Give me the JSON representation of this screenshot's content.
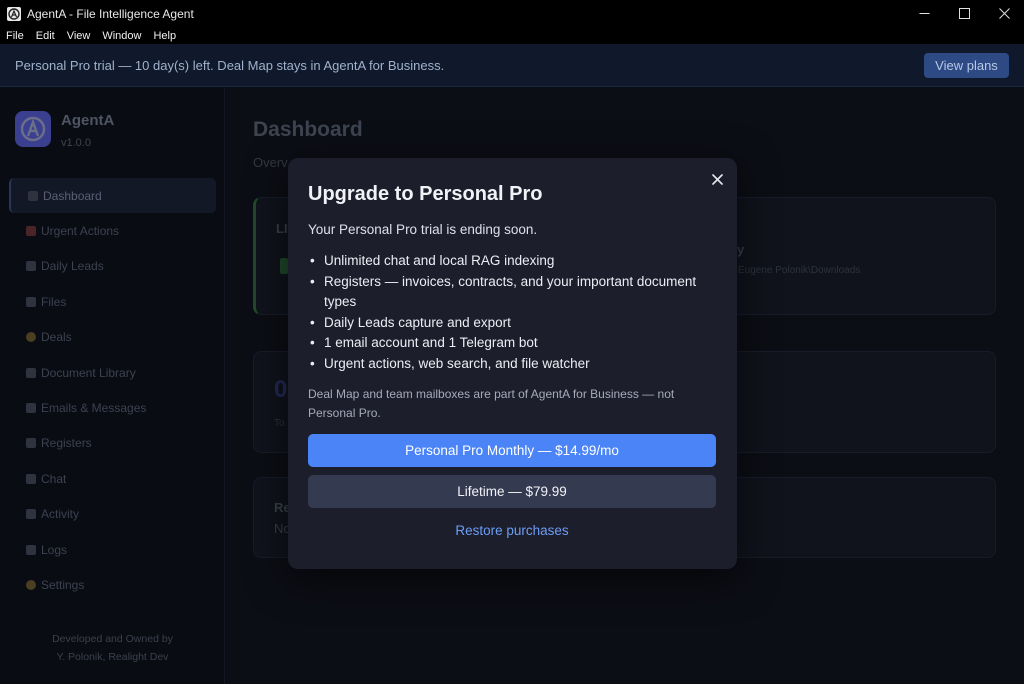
{
  "window": {
    "title": "AgentA - File Intelligence Agent",
    "app_icon": "agenta-logo-icon",
    "controls": [
      "minimize-icon",
      "maximize-icon",
      "close-icon"
    ]
  },
  "menu": [
    "File",
    "Edit",
    "View",
    "Window",
    "Help"
  ],
  "banner": {
    "text": "Personal Pro trial — 10 day(s) left. Deal Map stays in AgentA for Business.",
    "button": "View plans"
  },
  "sidebar": {
    "brand_name": "AgentA",
    "version": "v1.0.0",
    "items": [
      {
        "label": "Dashboard",
        "icon": "chart-icon"
      },
      {
        "label": "Urgent Actions",
        "icon": "siren-icon"
      },
      {
        "label": "Daily Leads",
        "icon": "calendar-icon"
      },
      {
        "label": "Files",
        "icon": "folder-icon"
      },
      {
        "label": "Deals",
        "icon": "coin-icon"
      },
      {
        "label": "Document Library",
        "icon": "books-icon"
      },
      {
        "label": "Emails & Messages",
        "icon": "envelope-icon"
      },
      {
        "label": "Registers",
        "icon": "register-icon"
      },
      {
        "label": "Chat",
        "icon": "chat-icon"
      },
      {
        "label": "Activity",
        "icon": "activity-icon"
      },
      {
        "label": "Logs",
        "icon": "log-icon"
      },
      {
        "label": "Settings",
        "icon": "gear-icon"
      }
    ],
    "active": "Dashboard",
    "footer_line1": "Developed and Owned by",
    "footer_line2": "Y. Polonik, Realight Dev"
  },
  "main": {
    "title": "Dashboard",
    "subtitle_partial": "Overv",
    "card1_label_partial": "LI",
    "card1_right_partial": "y",
    "card1_path_partial": "Eugene Polonik\\Downloads",
    "card2_number_partial": "0",
    "card2_label_partial": "To",
    "card3_label_partial": "Re",
    "card3_text_partial": "No"
  },
  "modal": {
    "title": "Upgrade to Personal Pro",
    "subtitle": "Your Personal Pro trial is ending soon.",
    "features": [
      "Unlimited chat and local RAG indexing",
      "Registers — invoices, contracts, and your important document types",
      "Daily Leads capture and export",
      "1 email account and 1 Telegram bot",
      "Urgent actions, web search, and file watcher"
    ],
    "note": "Deal Map and team mailboxes are part of AgentA for Business — not Personal Pro.",
    "primary_button": "Personal Pro Monthly — $14.99/mo",
    "secondary_button": "Lifetime — $79.99",
    "restore_link": "Restore purchases"
  },
  "colors": {
    "primary": "#4a84f7",
    "secondary": "#343b51",
    "link": "#6b9df5",
    "modal_bg": "#1d1e2c",
    "banner_bg": "#10192b"
  }
}
